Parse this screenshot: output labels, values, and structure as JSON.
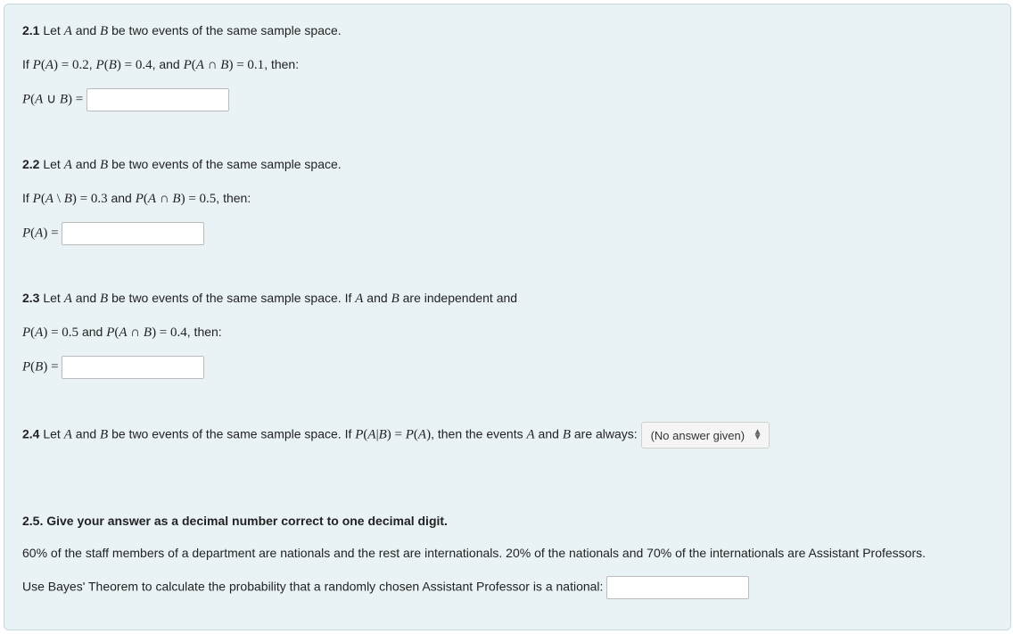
{
  "q21": {
    "num": "2.1",
    "line1_a": " Let ",
    "line1_b": " and ",
    "line1_c": " be two events of the same sample space.",
    "line2_a": "If ",
    "line2_b": ", ",
    "line2_c": ", and ",
    "line2_d": ", then:",
    "PA": "P(A) = 0.2",
    "PB": "P(B) = 0.4",
    "PAnB": "P(A ∩ B) = 0.1",
    "label": "P(A ∪ B) =",
    "A": "A",
    "B": "B",
    "value": ""
  },
  "q22": {
    "num": "2.2",
    "line1_a": " Let ",
    "line1_b": " and ",
    "line1_c": " be two events of the same sample space.",
    "line2_a": "If ",
    "line2_b": " and ",
    "line2_c": ", then:",
    "PAmB": "P(A \\ B) = 0.3",
    "PAnB": "P(A ∩ B) = 0.5",
    "label": "P(A) =",
    "A": "A",
    "B": "B",
    "value": ""
  },
  "q23": {
    "num": "2.3",
    "line1_a": " Let ",
    "line1_b": " and ",
    "line1_c": " be two events of the same sample space. If ",
    "line1_d": " and ",
    "line1_e": " are independent and",
    "line2_a": " and ",
    "line2_b": ", then:",
    "PA": "P(A) = 0.5",
    "PAnB": "P(A ∩ B) = 0.4",
    "label": "P(B) =",
    "A": "A",
    "B": "B",
    "value": ""
  },
  "q24": {
    "num": "2.4",
    "line1_a": " Let ",
    "line1_b": " and ",
    "line1_c": " be two events of the same sample space. If ",
    "line1_d": ", then the events ",
    "line1_e": " and ",
    "line1_f": " are always: ",
    "cond": "P(A|B) = P(A)",
    "A": "A",
    "B": "B",
    "select_value": "(No answer given)"
  },
  "q25": {
    "num": "2.5. Give your answer as a decimal number correct to one decimal digit.",
    "line2": "60% of the staff members of a department are nationals and the rest are internationals. 20% of the nationals and 70% of the internationals are Assistant Professors.",
    "line3": "Use Bayes' Theorem to calculate the probability that a randomly chosen Assistant Professor is a national: ",
    "value": ""
  }
}
